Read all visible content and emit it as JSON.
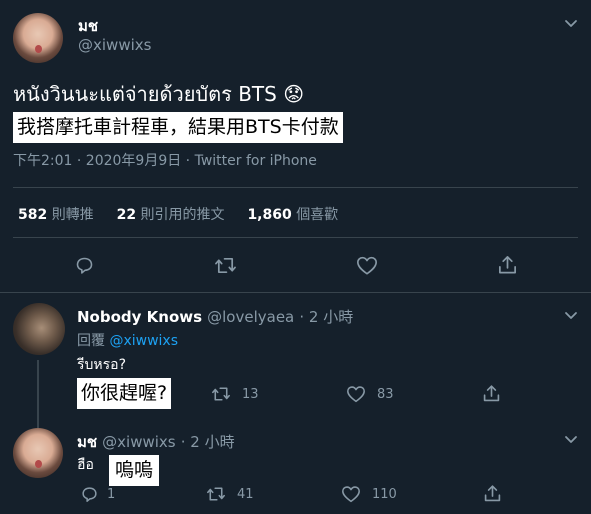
{
  "main_tweet": {
    "display_name": "มช",
    "handle": "@xiwwixs",
    "text": "หนังวินนะแต่จ่ายด้วยบัตร BTS",
    "emoji": "😟",
    "translation": "我搭摩托車計程車，結果用BTS卡付款",
    "meta": "下午2:01 · 2020年9月9日 · Twitter for iPhone",
    "stats": {
      "retweets_count": "582",
      "retweets_label": "則轉推",
      "quotes_count": "22",
      "quotes_label": "則引用的推文",
      "likes_count": "1,860",
      "likes_label": "個喜歡"
    }
  },
  "reply_1": {
    "display_name": "Nobody Knows",
    "handle": "@lovelyaea",
    "time": "· 2 小時",
    "reply_prefix": "回覆",
    "reply_to": "@xiwwixs",
    "text": "รีบหรอ?",
    "translation": "你很趕喔?",
    "retweets": "13",
    "likes": "83"
  },
  "reply_2": {
    "display_name": "มช",
    "handle": "@xiwwixs",
    "time": "· 2 小時",
    "text": "ฮือ",
    "translation": "嗚嗚",
    "replies": "1",
    "retweets": "41",
    "likes": "110"
  },
  "colors": {
    "background": "#15202b",
    "muted": "#8899a6",
    "accent": "#1da1f2",
    "divider": "#38444d"
  }
}
